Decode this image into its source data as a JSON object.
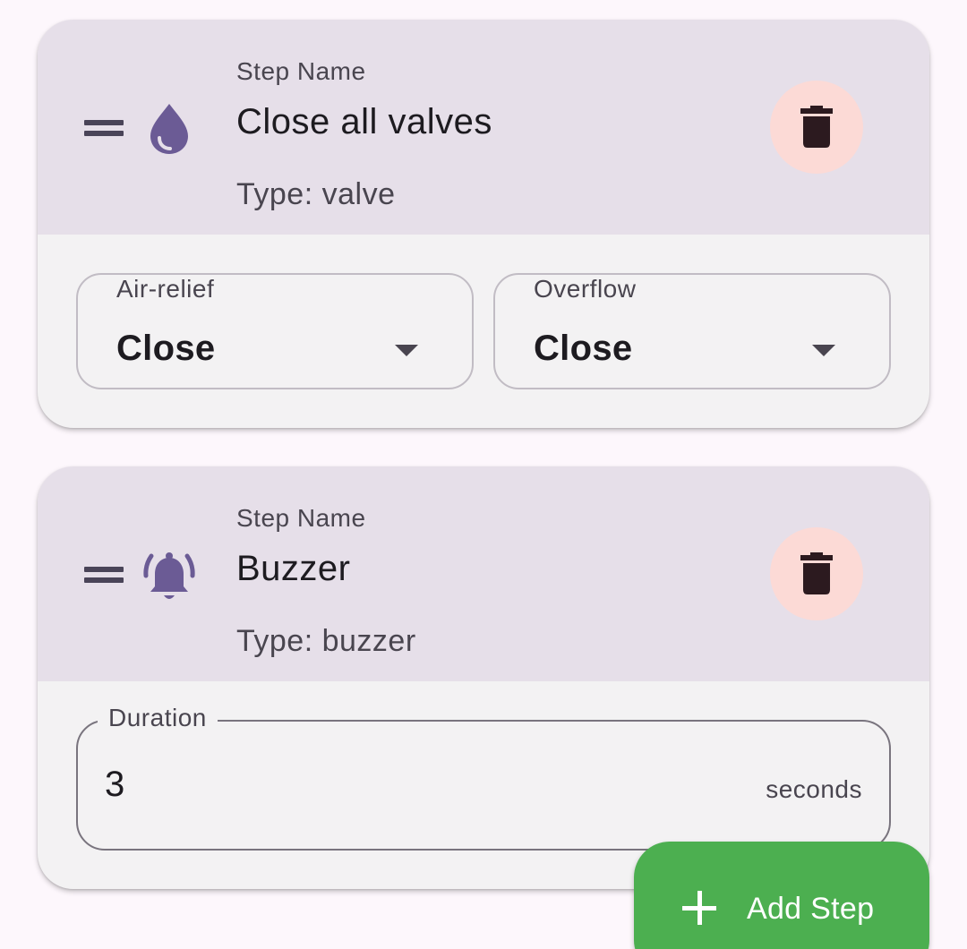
{
  "steps": [
    {
      "caption": "Step Name",
      "name": "Close all valves",
      "type_label": "Type: valve",
      "icon": "water-drop-icon",
      "fields": [
        {
          "label": "Air-relief",
          "value": "Close"
        },
        {
          "label": "Overflow",
          "value": "Close"
        }
      ]
    },
    {
      "caption": "Step Name",
      "name": "Buzzer",
      "type_label": "Type: buzzer",
      "icon": "bell-ringing-icon",
      "duration": {
        "label": "Duration",
        "value": "3",
        "suffix": "seconds"
      }
    }
  ],
  "fab": {
    "label": "Add Step",
    "icon": "plus-icon"
  },
  "colors": {
    "background": "#fdf7fc",
    "card_header": "#e6dfe9",
    "card_body": "#f3f2f3",
    "accent_icon": "#6b5b95",
    "delete_bg": "#fcdad6",
    "delete_icon": "#2c1a1f",
    "fab": "#4caf50"
  }
}
